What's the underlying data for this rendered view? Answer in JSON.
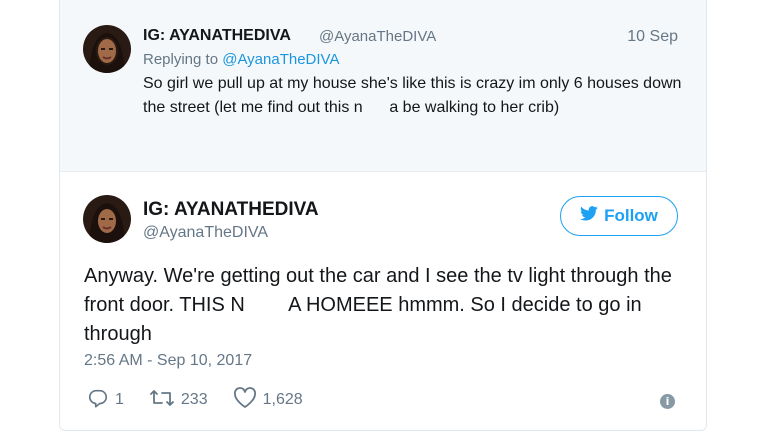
{
  "reply_tweet": {
    "display_name": "IG: AYANATHEDIVA",
    "handle": "@AyanaTheDIVA",
    "date": "10 Sep",
    "replying_prefix": "Replying to",
    "replying_handle": "@AyanaTheDIVA",
    "text": "So girl we pull up at my house she's like this is crazy im only 6 houses down the street (let me find out this n      a be walking to her crib)"
  },
  "main_tweet": {
    "display_name": "IG: AYANATHEDIVA",
    "handle": "@AyanaTheDIVA",
    "follow_label": "Follow",
    "text": "Anyway. We're getting out the car and I see the tv light through the front door. THIS N        A HOMEEE hmmm. So I decide to go in through",
    "timestamp": "2:56 AM - Sep 10, 2017",
    "replies": "1",
    "retweets": "233",
    "likes": "1,628"
  },
  "icons": {
    "reply": "reply-icon",
    "retweet": "retweet-icon",
    "like": "heart-icon",
    "info": "info-icon",
    "bird": "twitter-bird-icon"
  },
  "colors": {
    "accent": "#1da1f2",
    "muted": "#657786",
    "reply_bg": "#f5f8fa"
  }
}
